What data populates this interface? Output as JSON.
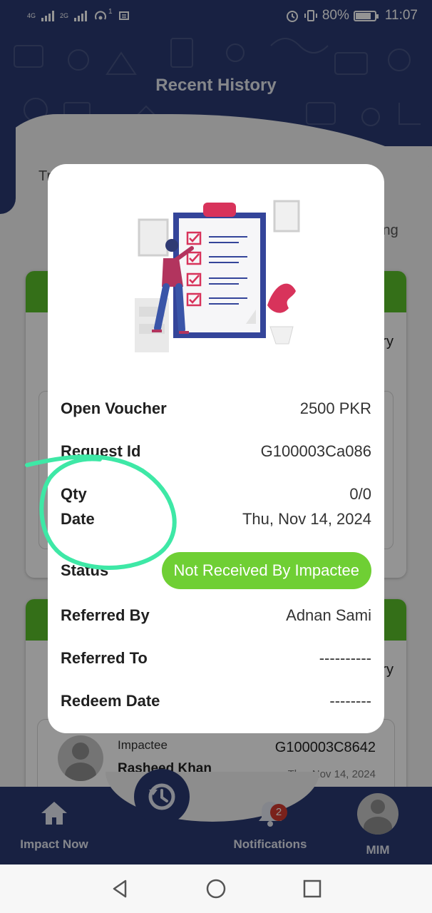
{
  "status_bar": {
    "network_1": "4G",
    "network_2": "2G",
    "hotspot_count": "1",
    "battery": "80%",
    "time": "11:07"
  },
  "header": {
    "title": "Recent History"
  },
  "background": {
    "partial_texts": [
      "Tr",
      "ing",
      "ry",
      "ry"
    ],
    "lower_card": {
      "role": "Impactee",
      "name": "Rasheed Khan",
      "id": "G100003C8642",
      "date": "Thu, Nov 14, 2024"
    }
  },
  "modal": {
    "rows": [
      {
        "label": "Open Voucher",
        "value": "2500 PKR"
      },
      {
        "label": "Request Id",
        "value": "G100003Ca086"
      },
      {
        "label": "Qty",
        "value": "0/0"
      },
      {
        "label": "Date",
        "value": "Thu, Nov 14, 2024"
      },
      {
        "label": "Status",
        "value": "Not Received By Impactee"
      },
      {
        "label": "Referred By",
        "value": "Adnan Sami"
      },
      {
        "label": "Referred To",
        "value": "----------"
      },
      {
        "label": "Redeem Date",
        "value": "--------"
      }
    ],
    "status_color": "#6fcf34"
  },
  "bottom_nav": {
    "items": [
      {
        "label": "Impact Now",
        "icon": "home-icon"
      },
      {
        "label": "",
        "icon": "history-icon"
      },
      {
        "label": "Notifications",
        "icon": "bell-icon",
        "badge": "2"
      },
      {
        "label": "MIM",
        "icon": "avatar"
      }
    ]
  },
  "colors": {
    "primary": "#2a3a72",
    "accent_green": "#5bbf2a",
    "badge_red": "#d33a2f",
    "annotation": "#3ee8a6"
  }
}
